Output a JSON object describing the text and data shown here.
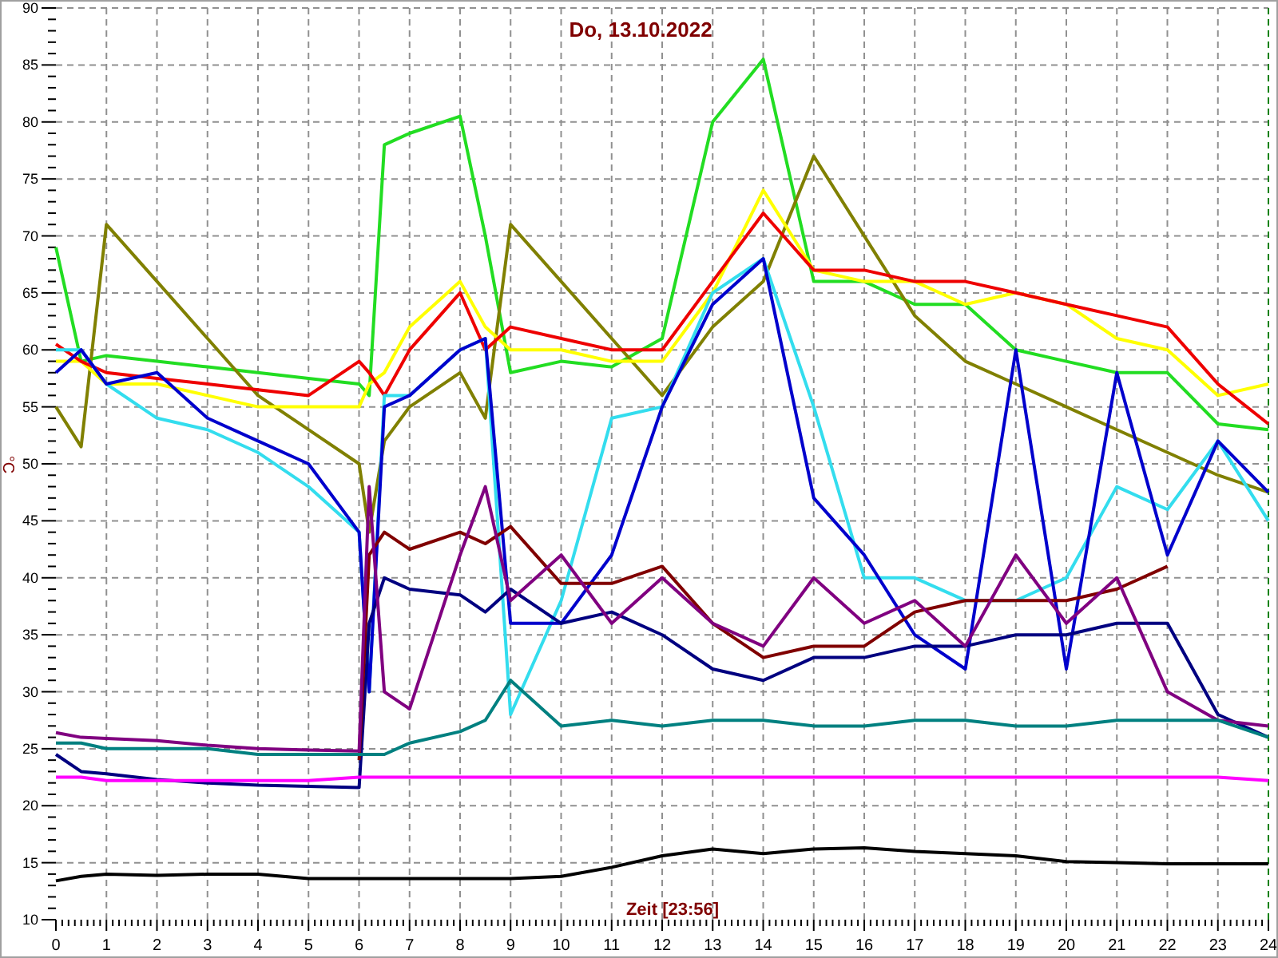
{
  "chart_data": {
    "type": "line",
    "title": "Do, 13.10.2022",
    "xlabel": "Zeit [23:56]",
    "ylabel": "°C",
    "x": [
      0,
      0.5,
      1,
      2,
      3,
      4,
      5,
      6,
      6.2,
      6.5,
      7,
      8,
      8.5,
      9,
      10,
      11,
      12,
      13,
      14,
      15,
      16,
      17,
      18,
      19,
      20,
      21,
      22,
      23,
      24
    ],
    "grid": true,
    "xlim": [
      0,
      24
    ],
    "ylim": [
      10,
      90
    ],
    "xticks": [
      0,
      1,
      2,
      3,
      4,
      5,
      6,
      7,
      8,
      9,
      10,
      11,
      12,
      13,
      14,
      15,
      16,
      17,
      18,
      19,
      20,
      21,
      22,
      23,
      24
    ],
    "yticks": [
      10,
      15,
      20,
      25,
      30,
      35,
      40,
      45,
      50,
      55,
      60,
      65,
      70,
      75,
      80,
      85,
      90
    ],
    "series": [
      {
        "color": "#22dd22",
        "values": [
          69,
          59,
          59.5,
          59,
          58.5,
          58,
          57.5,
          57,
          56,
          78,
          79,
          80.5,
          70,
          58,
          59,
          58.5,
          61,
          80,
          85.5,
          66,
          66,
          64,
          64,
          60,
          59,
          58,
          58,
          53.5,
          53
        ]
      },
      {
        "color": "#808000",
        "values": [
          55,
          51.5,
          71,
          66,
          61,
          56,
          53,
          50,
          44,
          52,
          55,
          58,
          54,
          71,
          66,
          61,
          56,
          62,
          66,
          77,
          70,
          63,
          59,
          57,
          55,
          53,
          51,
          49,
          47.5
        ]
      },
      {
        "color": "#ffff00",
        "values": [
          59,
          59,
          57,
          57,
          56,
          55,
          55,
          55,
          57,
          58,
          62,
          66,
          62,
          60,
          60,
          59,
          59,
          65,
          74,
          67,
          66,
          66,
          64,
          65,
          64,
          61,
          60,
          56,
          57
        ]
      },
      {
        "color": "#ee0000",
        "values": [
          60.5,
          59,
          58,
          57.5,
          57,
          56.5,
          56,
          59,
          58,
          56,
          60,
          65,
          60,
          62,
          61,
          60,
          60,
          66,
          72,
          67,
          67,
          66,
          66,
          65,
          64,
          63,
          62,
          57,
          53.5
        ]
      },
      {
        "color": "#33ddee",
        "values": [
          60,
          60,
          57,
          54,
          53,
          51,
          48,
          44,
          30,
          56,
          56,
          60,
          61,
          28,
          38,
          54,
          55,
          65,
          68,
          55,
          40,
          40,
          38,
          38,
          40,
          48,
          46,
          52,
          45
        ]
      },
      {
        "color": "#0000cc",
        "values": [
          58,
          60,
          57,
          58,
          54,
          52,
          50,
          44,
          30,
          55,
          56,
          60,
          61,
          36,
          36,
          42,
          55,
          64,
          68,
          47,
          42,
          35,
          32,
          60,
          32,
          58,
          42,
          52,
          47.5
        ]
      },
      {
        "color": "#000080",
        "values": [
          24.5,
          23,
          22.8,
          22.3,
          22,
          21.8,
          21.7,
          21.6,
          36,
          40,
          39,
          38.5,
          37,
          39,
          36,
          37,
          35,
          32,
          31,
          33,
          33,
          34,
          34,
          35,
          35,
          36,
          36,
          28,
          26
        ]
      },
      {
        "color": "#800000",
        "values": [
          null,
          null,
          null,
          null,
          null,
          null,
          null,
          24,
          42,
          44,
          42.5,
          44,
          43,
          44.5,
          39.5,
          39.5,
          41,
          36,
          33,
          34,
          34,
          37,
          38,
          38,
          38,
          39,
          41,
          null,
          null
        ]
      },
      {
        "color": "#800080",
        "values": [
          26.4,
          26,
          25.9,
          25.7,
          25.3,
          25,
          24.9,
          24.8,
          48,
          30,
          28.5,
          42,
          48,
          38,
          42,
          36,
          40,
          36,
          34,
          40,
          36,
          38,
          34,
          42,
          36,
          40,
          30,
          27.5,
          27
        ]
      },
      {
        "color": "#008080",
        "values": [
          25.5,
          25.5,
          25,
          25,
          25,
          24.5,
          24.5,
          24.5,
          24.5,
          24.5,
          25.5,
          26.5,
          27.5,
          31,
          27,
          27.5,
          27,
          27.5,
          27.5,
          27,
          27,
          27.5,
          27.5,
          27,
          27,
          27.5,
          27.5,
          27.5,
          26
        ]
      },
      {
        "color": "#ff00ff",
        "values": [
          22.5,
          22.5,
          22.2,
          22.2,
          22.2,
          22.2,
          22.2,
          22.5,
          22.5,
          22.5,
          22.5,
          22.5,
          22.5,
          22.5,
          22.5,
          22.5,
          22.5,
          22.5,
          22.5,
          22.5,
          22.5,
          22.5,
          22.5,
          22.5,
          22.5,
          22.5,
          22.5,
          22.5,
          22.2
        ]
      },
      {
        "color": "#000000",
        "values": [
          13.4,
          13.8,
          14,
          13.9,
          14,
          14,
          13.6,
          13.6,
          13.6,
          13.6,
          13.6,
          13.6,
          13.6,
          13.6,
          13.8,
          14.6,
          15.6,
          16.2,
          15.8,
          16.2,
          16.3,
          16,
          15.8,
          15.6,
          15.1,
          15,
          14.9,
          14.9,
          14.9
        ]
      }
    ]
  }
}
